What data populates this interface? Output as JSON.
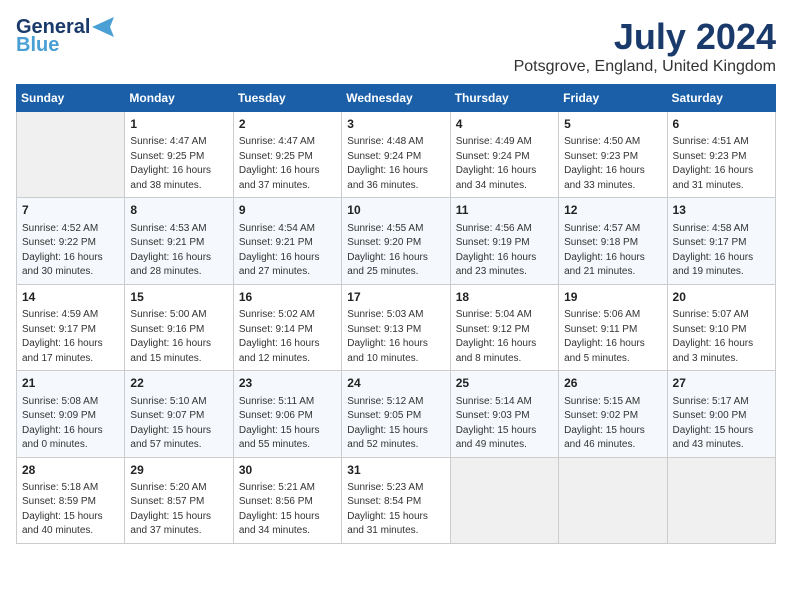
{
  "header": {
    "logo_line1": "General",
    "logo_line2": "Blue",
    "month_year": "July 2024",
    "location": "Potsgrove, England, United Kingdom"
  },
  "days_of_week": [
    "Sunday",
    "Monday",
    "Tuesday",
    "Wednesday",
    "Thursday",
    "Friday",
    "Saturday"
  ],
  "weeks": [
    [
      {
        "day": "",
        "sunrise": "",
        "sunset": "",
        "daylight": ""
      },
      {
        "day": "1",
        "sunrise": "Sunrise: 4:47 AM",
        "sunset": "Sunset: 9:25 PM",
        "daylight": "Daylight: 16 hours and 38 minutes."
      },
      {
        "day": "2",
        "sunrise": "Sunrise: 4:47 AM",
        "sunset": "Sunset: 9:25 PM",
        "daylight": "Daylight: 16 hours and 37 minutes."
      },
      {
        "day": "3",
        "sunrise": "Sunrise: 4:48 AM",
        "sunset": "Sunset: 9:24 PM",
        "daylight": "Daylight: 16 hours and 36 minutes."
      },
      {
        "day": "4",
        "sunrise": "Sunrise: 4:49 AM",
        "sunset": "Sunset: 9:24 PM",
        "daylight": "Daylight: 16 hours and 34 minutes."
      },
      {
        "day": "5",
        "sunrise": "Sunrise: 4:50 AM",
        "sunset": "Sunset: 9:23 PM",
        "daylight": "Daylight: 16 hours and 33 minutes."
      },
      {
        "day": "6",
        "sunrise": "Sunrise: 4:51 AM",
        "sunset": "Sunset: 9:23 PM",
        "daylight": "Daylight: 16 hours and 31 minutes."
      }
    ],
    [
      {
        "day": "7",
        "sunrise": "Sunrise: 4:52 AM",
        "sunset": "Sunset: 9:22 PM",
        "daylight": "Daylight: 16 hours and 30 minutes."
      },
      {
        "day": "8",
        "sunrise": "Sunrise: 4:53 AM",
        "sunset": "Sunset: 9:21 PM",
        "daylight": "Daylight: 16 hours and 28 minutes."
      },
      {
        "day": "9",
        "sunrise": "Sunrise: 4:54 AM",
        "sunset": "Sunset: 9:21 PM",
        "daylight": "Daylight: 16 hours and 27 minutes."
      },
      {
        "day": "10",
        "sunrise": "Sunrise: 4:55 AM",
        "sunset": "Sunset: 9:20 PM",
        "daylight": "Daylight: 16 hours and 25 minutes."
      },
      {
        "day": "11",
        "sunrise": "Sunrise: 4:56 AM",
        "sunset": "Sunset: 9:19 PM",
        "daylight": "Daylight: 16 hours and 23 minutes."
      },
      {
        "day": "12",
        "sunrise": "Sunrise: 4:57 AM",
        "sunset": "Sunset: 9:18 PM",
        "daylight": "Daylight: 16 hours and 21 minutes."
      },
      {
        "day": "13",
        "sunrise": "Sunrise: 4:58 AM",
        "sunset": "Sunset: 9:17 PM",
        "daylight": "Daylight: 16 hours and 19 minutes."
      }
    ],
    [
      {
        "day": "14",
        "sunrise": "Sunrise: 4:59 AM",
        "sunset": "Sunset: 9:17 PM",
        "daylight": "Daylight: 16 hours and 17 minutes."
      },
      {
        "day": "15",
        "sunrise": "Sunrise: 5:00 AM",
        "sunset": "Sunset: 9:16 PM",
        "daylight": "Daylight: 16 hours and 15 minutes."
      },
      {
        "day": "16",
        "sunrise": "Sunrise: 5:02 AM",
        "sunset": "Sunset: 9:14 PM",
        "daylight": "Daylight: 16 hours and 12 minutes."
      },
      {
        "day": "17",
        "sunrise": "Sunrise: 5:03 AM",
        "sunset": "Sunset: 9:13 PM",
        "daylight": "Daylight: 16 hours and 10 minutes."
      },
      {
        "day": "18",
        "sunrise": "Sunrise: 5:04 AM",
        "sunset": "Sunset: 9:12 PM",
        "daylight": "Daylight: 16 hours and 8 minutes."
      },
      {
        "day": "19",
        "sunrise": "Sunrise: 5:06 AM",
        "sunset": "Sunset: 9:11 PM",
        "daylight": "Daylight: 16 hours and 5 minutes."
      },
      {
        "day": "20",
        "sunrise": "Sunrise: 5:07 AM",
        "sunset": "Sunset: 9:10 PM",
        "daylight": "Daylight: 16 hours and 3 minutes."
      }
    ],
    [
      {
        "day": "21",
        "sunrise": "Sunrise: 5:08 AM",
        "sunset": "Sunset: 9:09 PM",
        "daylight": "Daylight: 16 hours and 0 minutes."
      },
      {
        "day": "22",
        "sunrise": "Sunrise: 5:10 AM",
        "sunset": "Sunset: 9:07 PM",
        "daylight": "Daylight: 15 hours and 57 minutes."
      },
      {
        "day": "23",
        "sunrise": "Sunrise: 5:11 AM",
        "sunset": "Sunset: 9:06 PM",
        "daylight": "Daylight: 15 hours and 55 minutes."
      },
      {
        "day": "24",
        "sunrise": "Sunrise: 5:12 AM",
        "sunset": "Sunset: 9:05 PM",
        "daylight": "Daylight: 15 hours and 52 minutes."
      },
      {
        "day": "25",
        "sunrise": "Sunrise: 5:14 AM",
        "sunset": "Sunset: 9:03 PM",
        "daylight": "Daylight: 15 hours and 49 minutes."
      },
      {
        "day": "26",
        "sunrise": "Sunrise: 5:15 AM",
        "sunset": "Sunset: 9:02 PM",
        "daylight": "Daylight: 15 hours and 46 minutes."
      },
      {
        "day": "27",
        "sunrise": "Sunrise: 5:17 AM",
        "sunset": "Sunset: 9:00 PM",
        "daylight": "Daylight: 15 hours and 43 minutes."
      }
    ],
    [
      {
        "day": "28",
        "sunrise": "Sunrise: 5:18 AM",
        "sunset": "Sunset: 8:59 PM",
        "daylight": "Daylight: 15 hours and 40 minutes."
      },
      {
        "day": "29",
        "sunrise": "Sunrise: 5:20 AM",
        "sunset": "Sunset: 8:57 PM",
        "daylight": "Daylight: 15 hours and 37 minutes."
      },
      {
        "day": "30",
        "sunrise": "Sunrise: 5:21 AM",
        "sunset": "Sunset: 8:56 PM",
        "daylight": "Daylight: 15 hours and 34 minutes."
      },
      {
        "day": "31",
        "sunrise": "Sunrise: 5:23 AM",
        "sunset": "Sunset: 8:54 PM",
        "daylight": "Daylight: 15 hours and 31 minutes."
      },
      {
        "day": "",
        "sunrise": "",
        "sunset": "",
        "daylight": ""
      },
      {
        "day": "",
        "sunrise": "",
        "sunset": "",
        "daylight": ""
      },
      {
        "day": "",
        "sunrise": "",
        "sunset": "",
        "daylight": ""
      }
    ]
  ]
}
